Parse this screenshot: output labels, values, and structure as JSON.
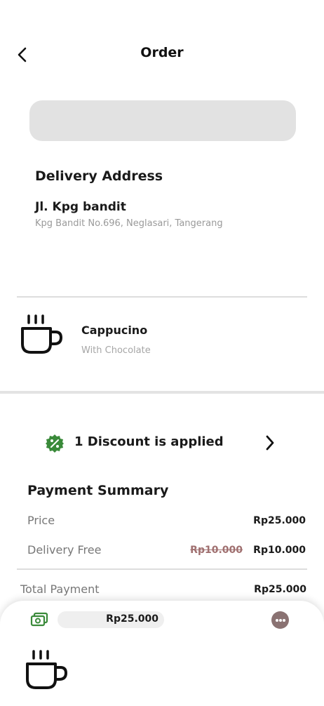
{
  "header": {
    "title": "Order",
    "back_icon": "chevron-left-icon"
  },
  "delivery": {
    "heading": "Delivery Address",
    "street": "Jl. Kpg bandit",
    "detail": "Kpg Bandit No.696, Neglasari, Tangerang"
  },
  "item": {
    "icon": "coffee-cup-icon",
    "name": "Cappucino",
    "note": "With Chocolate"
  },
  "discount": {
    "icon": "discount-badge-icon",
    "text": "1 Discount is applied",
    "chevron": "chevron-right-icon",
    "icon_color": "#3a8a3a"
  },
  "summary": {
    "title": "Payment Summary",
    "price_label": "Price",
    "price_value": "Rp25.000",
    "delivery_label": "Delivery Free",
    "delivery_original": "Rp10.000",
    "delivery_value": "Rp10.000",
    "total_label": "Total Payment",
    "total_value": "Rp25.000"
  },
  "bottom_bar": {
    "cash_icon": "cash-icon",
    "amount": "Rp25.000",
    "more_icon": "more-options-icon",
    "order_icon": "coffee-cup-icon",
    "accent": "#3a8a3a"
  }
}
